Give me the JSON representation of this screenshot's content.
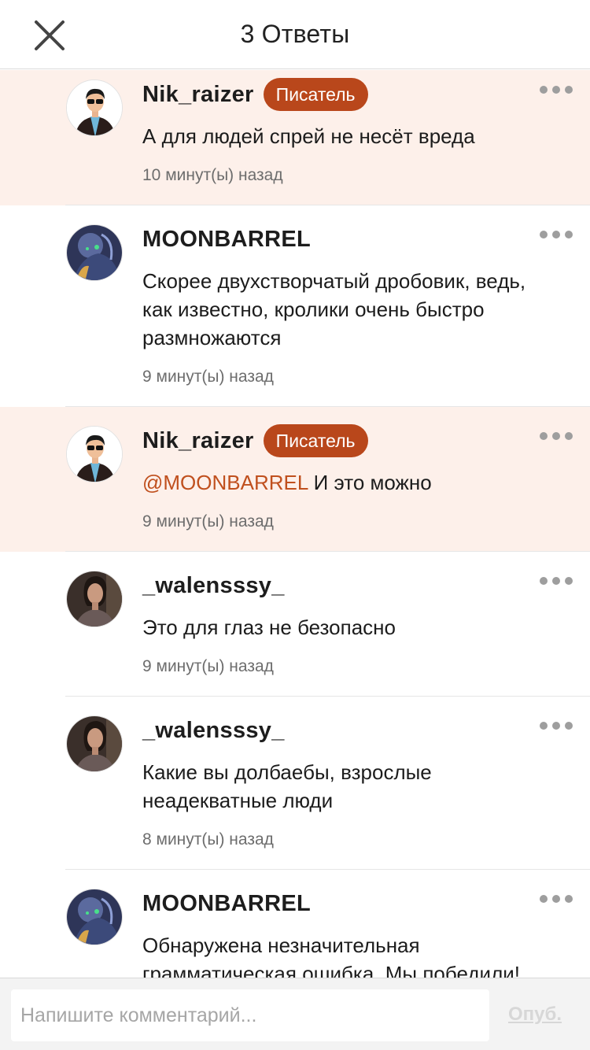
{
  "header": {
    "title": "3 Ответы",
    "close_icon": "close-icon"
  },
  "comments": [
    {
      "username": "Nik_raizer",
      "badge": "Писатель",
      "mention": "",
      "text": "А для людей спрей не несёт вреда",
      "time": "10 минут(ы) назад",
      "highlighted": true,
      "avatar": "avatar-man-sunglasses"
    },
    {
      "username": "MOONBARREL",
      "badge": "",
      "mention": "",
      "text": "Скорее двухстворчатый дробовик, ведь, как известно, кролики очень быстро размножаются",
      "time": "9 минут(ы) назад",
      "highlighted": false,
      "avatar": "avatar-dark-figure"
    },
    {
      "username": "Nik_raizer",
      "badge": "Писатель",
      "mention": "@MOONBARREL",
      "text": "И это можно",
      "time": "9 минут(ы) назад",
      "highlighted": true,
      "avatar": "avatar-man-sunglasses"
    },
    {
      "username": "_walensssy_",
      "badge": "",
      "mention": "",
      "text": "Это для глаз не безопасно",
      "time": "9 минут(ы) назад",
      "highlighted": false,
      "avatar": "avatar-woman-portrait"
    },
    {
      "username": "_walensssy_",
      "badge": "",
      "mention": "",
      "text": "Какие вы долбаебы, взрослые неадекватные люди",
      "time": "8 минут(ы) назад",
      "highlighted": false,
      "avatar": "avatar-woman-portrait"
    },
    {
      "username": "MOONBARREL",
      "badge": "",
      "mention": "",
      "text": "Обнаружена незначительная грамматическая ошибка. Мы победили!",
      "time": "",
      "highlighted": false,
      "avatar": "avatar-dark-figure"
    }
  ],
  "footer": {
    "input_placeholder": "Напишите комментарий...",
    "input_value": "",
    "publish_label": "Опуб."
  },
  "colors": {
    "highlight_bg": "#fdf0ea",
    "badge_bg": "#b9471b",
    "mention": "#c0501e",
    "publish_disabled": "#d7d7d7"
  }
}
